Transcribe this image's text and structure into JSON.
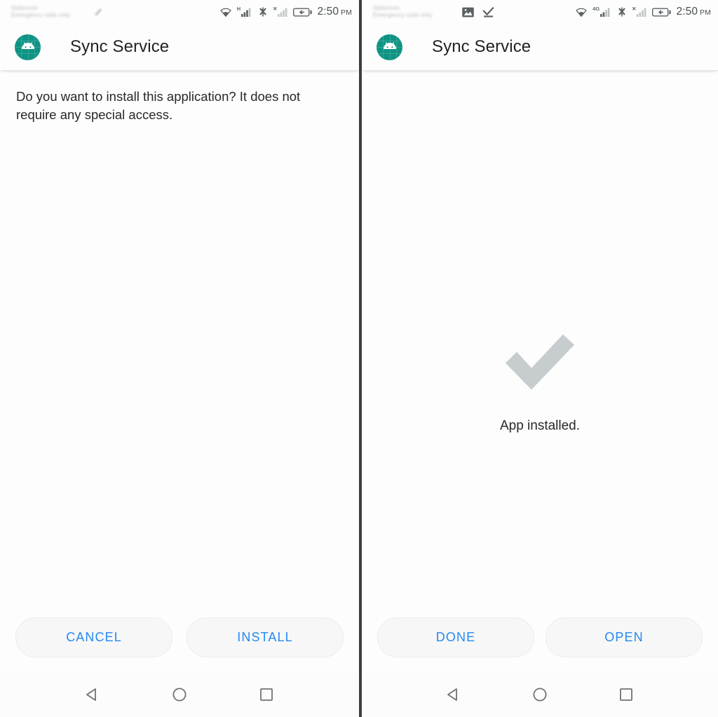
{
  "screens": [
    {
      "id": "install-prompt",
      "statusbar": {
        "carrier_line1": "Safaricom",
        "carrier_line2": "Emergency calls only",
        "network_label": "H",
        "clock_time": "2:50",
        "clock_ampm": "PM",
        "notification_icons": [],
        "icons": [
          "wifi-icon",
          "signal-icon",
          "bluetooth-off-icon",
          "signal-off-icon",
          "battery-charging-icon"
        ]
      },
      "appbar": {
        "icon": "android-app-icon",
        "title": "Sync Service"
      },
      "body": {
        "prompt": "Do you want to install this application? It does not require any special access."
      },
      "buttons": [
        {
          "label": "CANCEL",
          "name": "cancel-button"
        },
        {
          "label": "INSTALL",
          "name": "install-button"
        }
      ]
    },
    {
      "id": "install-complete",
      "statusbar": {
        "carrier_line1": "Safaricom",
        "carrier_line2": "Emergency calls only",
        "network_label": "4G",
        "clock_time": "2:50",
        "clock_ampm": "PM",
        "notification_icons": [
          "image-icon",
          "download-complete-icon"
        ],
        "icons": [
          "wifi-icon",
          "signal-icon",
          "bluetooth-off-icon",
          "signal-off-icon",
          "battery-charging-icon"
        ]
      },
      "appbar": {
        "icon": "android-app-icon",
        "title": "Sync Service"
      },
      "body": {
        "status_icon": "checkmark-icon",
        "status_text": "App installed."
      },
      "buttons": [
        {
          "label": "DONE",
          "name": "done-button"
        },
        {
          "label": "OPEN",
          "name": "open-button"
        }
      ]
    }
  ],
  "navbar": {
    "back_label": "back-button",
    "home_label": "home-button",
    "recents_label": "recents-button"
  },
  "colors": {
    "accent_blue": "#2489f2",
    "app_icon_teal": "#0e9384",
    "checkmark_gray": "#c7ccce",
    "text_primary": "#26282b",
    "divider": "#3c3f41"
  }
}
